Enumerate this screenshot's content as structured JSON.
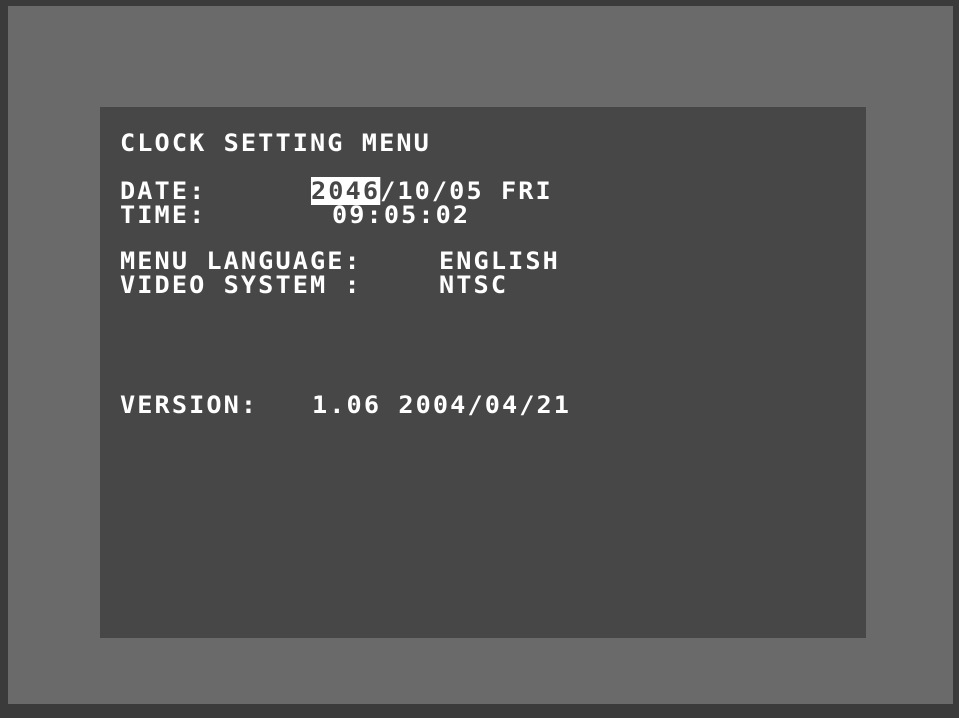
{
  "menu": {
    "title": "CLOCK SETTING MENU",
    "date_label": "DATE:",
    "date_year": "2046",
    "date_rest": "/10/05 FRI",
    "time_label": "TIME:",
    "time_value": "09:05:02",
    "language_label": "MENU LANGUAGE:",
    "language_value": "ENGLISH",
    "video_label": "VIDEO SYSTEM :",
    "video_value": "NTSC",
    "version_label": "VERSION:",
    "version_value": "1.06 2004/04/21"
  },
  "colors": {
    "screen_bg": "#474747",
    "bezel": "#6a6a6a",
    "text": "#ffffff"
  }
}
